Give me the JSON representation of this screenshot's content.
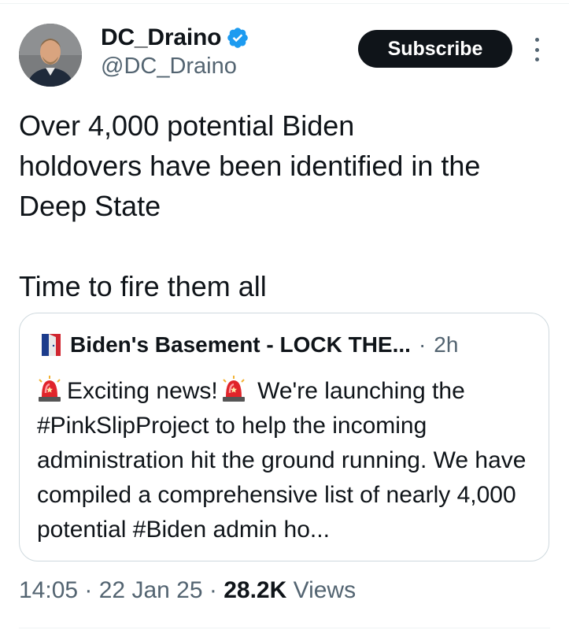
{
  "author": {
    "display_name": "DC_Draino",
    "handle": "@DC_Draino",
    "verified": true,
    "verified_color": "#1d9bf0"
  },
  "actions": {
    "subscribe_label": "Subscribe",
    "more_icon": "more-vertical-icon"
  },
  "tweet": {
    "text": "Over 4,000 potential Biden\nholdovers have been identified in the\nDeep State\n\nTime to fire them all"
  },
  "quoted_tweet": {
    "author_name": "Biden's Basement - LOCK THE...",
    "separator": "·",
    "time": "2h",
    "segments": {
      "part1": "Exciting news!",
      "part2": " We're launching the #PinkSlipProject to help the incoming administration hit the ground running. We have compiled a comprehensive list of nearly 4,000 potential #Biden admin ho..."
    },
    "emoji_icon": "police-light-icon"
  },
  "meta": {
    "time": "14:05",
    "sep1": " · ",
    "date": "22 Jan 25",
    "sep2": " · ",
    "views_count": "28.2K",
    "views_label": " Views"
  },
  "colors": {
    "text": "#0f1419",
    "secondary": "#536471",
    "border": "#cfd9de",
    "button_bg": "#0f1419"
  }
}
